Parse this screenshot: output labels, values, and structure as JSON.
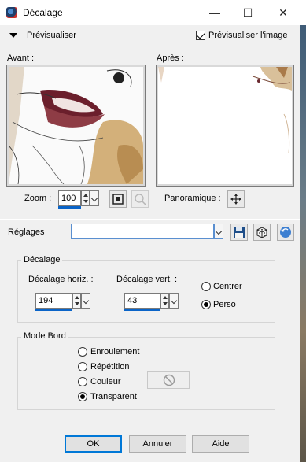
{
  "window": {
    "title": "Décalage",
    "minimize": "—",
    "maximize": "☐",
    "close": "✕"
  },
  "preview": {
    "toggle_label": "Prévisualiser",
    "preview_image_label": "Prévisualiser l'image",
    "preview_image_checked": true,
    "before_label": "Avant :",
    "after_label": "Après :"
  },
  "zoom": {
    "label": "Zoom :",
    "value": "100"
  },
  "pan": {
    "label": "Panoramique :"
  },
  "presets": {
    "label": "Réglages",
    "value": ""
  },
  "offset_group": {
    "title": "Décalage",
    "horiz_label": "Décalage horiz. :",
    "horiz_value": "194",
    "vert_label": "Décalage vert. :",
    "vert_value": "43",
    "center_label": "Centrer",
    "custom_label": "Perso",
    "selected": "Perso"
  },
  "edge_group": {
    "title": "Mode Bord",
    "options": [
      "Enroulement",
      "Répétition",
      "Couleur",
      "Transparent"
    ],
    "selected": "Transparent"
  },
  "buttons": {
    "ok": "OK",
    "cancel": "Annuler",
    "help": "Aide"
  },
  "colors": {
    "accent": "#0078d7",
    "spin_bar": "#0a64c8"
  }
}
